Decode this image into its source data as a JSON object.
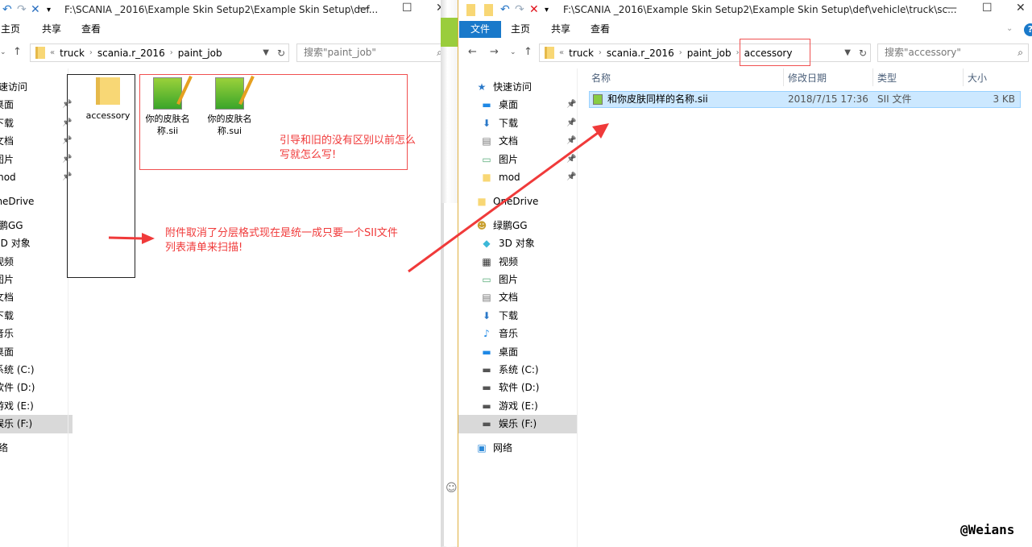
{
  "left": {
    "title": "F:\\SCANIA _2016\\Example Skin Setup2\\Example Skin Setup\\def...",
    "ribbon": [
      "主页",
      "共享",
      "查看"
    ],
    "crumbs": [
      "truck",
      "scania.r_2016",
      "paint_job"
    ],
    "search_placeholder": "搜索\"paint_job\"",
    "items": [
      {
        "label": "accessory",
        "type": "folder"
      },
      {
        "label": "你的皮肤名称.sii",
        "type": "sii"
      },
      {
        "label": "你的皮肤名称.sui",
        "type": "sii"
      }
    ]
  },
  "right": {
    "title": "F:\\SCANIA _2016\\Example Skin Setup2\\Example Skin Setup\\def\\vehicle\\truck\\sc...",
    "ribbon_file": "文件",
    "ribbon": [
      "主页",
      "共享",
      "查看"
    ],
    "crumbs": [
      "truck",
      "scania.r_2016",
      "paint_job",
      "accessory"
    ],
    "search_placeholder": "搜索\"accessory\"",
    "columns": [
      "名称",
      "修改日期",
      "类型",
      "大小"
    ],
    "files": [
      {
        "name": "和你皮肤同样的名称.sii",
        "date": "2018/7/15 17:36",
        "type": "SII 文件",
        "size": "3 KB"
      }
    ]
  },
  "sidebar": [
    {
      "label": "快速访问",
      "icon": "star-icon",
      "level": 0
    },
    {
      "label": "桌面",
      "icon": "desktop-icon",
      "level": 1,
      "pinned": true
    },
    {
      "label": "下载",
      "icon": "download-icon",
      "level": 1,
      "pinned": true
    },
    {
      "label": "文档",
      "icon": "document-icon",
      "level": 1,
      "pinned": true
    },
    {
      "label": "图片",
      "icon": "pictures-icon",
      "level": 1,
      "pinned": true
    },
    {
      "label": "mod",
      "icon": "folder-icon",
      "level": 1,
      "pinned": true
    },
    {
      "label": "OneDrive",
      "icon": "folder-icon",
      "level": 0,
      "gap": true
    },
    {
      "label": "绿鹏GG",
      "icon": "user-icon",
      "level": 0,
      "gap": true
    },
    {
      "label": "3D 对象",
      "icon": "cube-icon",
      "level": 1
    },
    {
      "label": "视频",
      "icon": "video-icon",
      "level": 1
    },
    {
      "label": "图片",
      "icon": "pictures-icon",
      "level": 1
    },
    {
      "label": "文档",
      "icon": "document-icon",
      "level": 1
    },
    {
      "label": "下载",
      "icon": "download-icon",
      "level": 1
    },
    {
      "label": "音乐",
      "icon": "music-icon",
      "level": 1
    },
    {
      "label": "桌面",
      "icon": "desktop-icon",
      "level": 1
    },
    {
      "label": "系统 (C:)",
      "icon": "drive-icon",
      "level": 1
    },
    {
      "label": "软件 (D:)",
      "icon": "drive-icon",
      "level": 1
    },
    {
      "label": "游戏 (E:)",
      "icon": "drive-icon",
      "level": 1
    },
    {
      "label": "娱乐 (F:)",
      "icon": "drive-icon",
      "level": 1,
      "selected": true
    },
    {
      "label": "网络",
      "icon": "network-icon",
      "level": 0,
      "gap": true
    }
  ],
  "annotations": {
    "note1": [
      "引导和旧的没有区别以前怎么",
      "写就怎么写!"
    ],
    "note2": [
      "附件取消了分层格式现在是统一成只要一个SII文件",
      "列表清单来扫描!"
    ],
    "color": "#f03a3a"
  },
  "watermark": "@Weians"
}
